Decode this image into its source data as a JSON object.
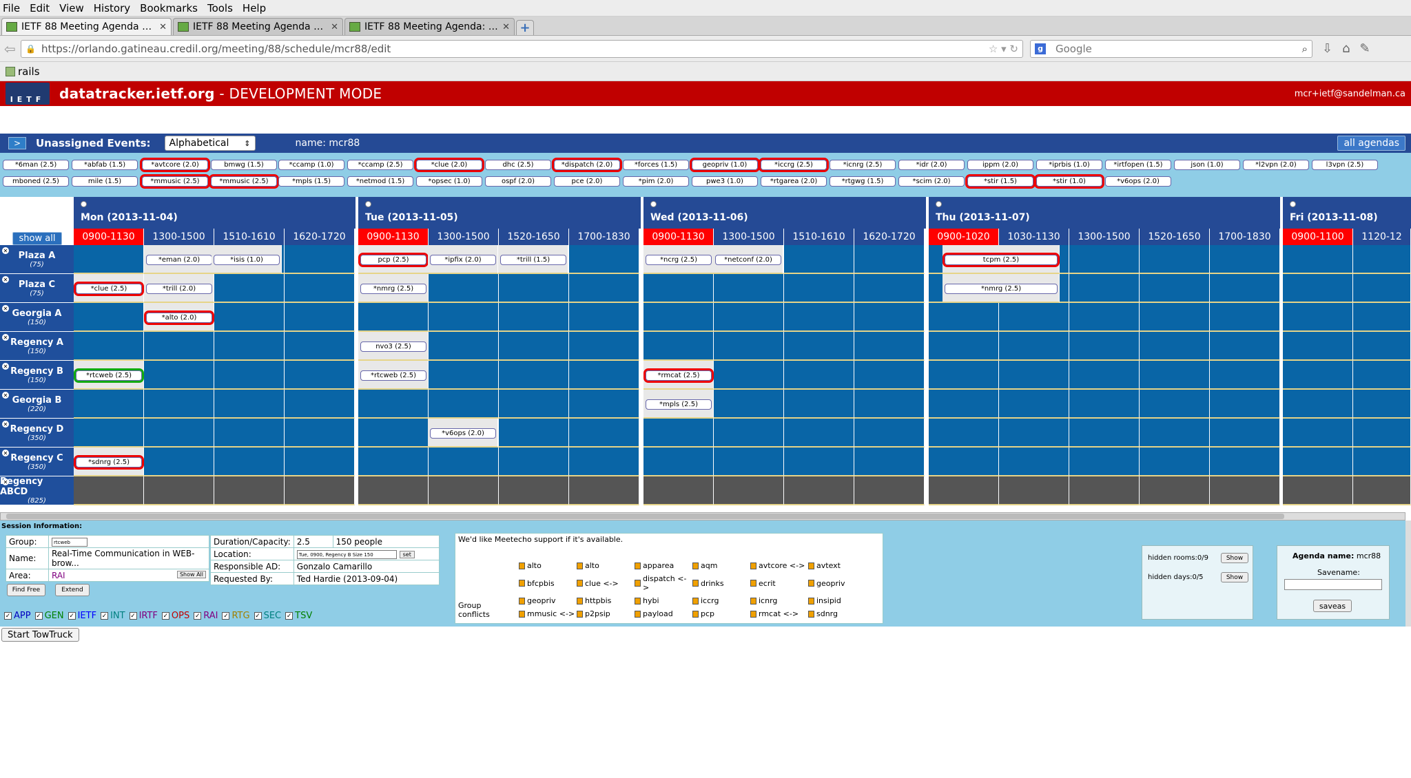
{
  "menu": [
    "File",
    "Edit",
    "View",
    "History",
    "Bookmarks",
    "Tools",
    "Help"
  ],
  "tabs": [
    {
      "title": "IETF 88 Meeting Agenda - D...",
      "active": true
    },
    {
      "title": "IETF 88 Meeting Agenda - D...",
      "active": false
    },
    {
      "title": "IETF 88 Meeting Agenda: Ti...",
      "active": false
    }
  ],
  "nav": {
    "url": "https://orlando.gatineau.credil.org/meeting/88/schedule/mcr88/edit",
    "search_placeholder": "Google"
  },
  "bookmarks": [
    "rails"
  ],
  "site": {
    "name": "datatracker.ietf.org",
    "mode": " - DEVELOPMENT MODE",
    "user": "mcr+ietf@sandelman.ca",
    "logo": "IETF"
  },
  "unassigned_bar": {
    "toggle": ">",
    "title": "Unassigned Events:",
    "sort": "Alphabetical",
    "name": "name: mcr88",
    "all_agendas": "all agendas"
  },
  "unassigned_row1": [
    "*6man (2.5)",
    "*abfab (1.5)",
    "*avtcore (2.0)",
    "bmwg (1.5)",
    "*ccamp (1.0)",
    "*ccamp (2.5)",
    "*clue (2.0)",
    "dhc (2.5)",
    "*dispatch (2.0)",
    "*forces (1.5)",
    "geopriv (1.0)",
    "*iccrg (2.5)",
    "*icnrg (2.5)",
    "*idr (2.0)",
    "ippm (2.0)",
    "*iprbis (1.0)",
    "*irtfopen (1.5)",
    "json (1.0)",
    "*l2vpn (2.0)",
    "l3vpn (2.5)"
  ],
  "unassigned_row2": [
    "mboned (2.5)",
    "mile (1.5)",
    "*mmusic (2.5)",
    "*mmusic (2.5)",
    "*mpls (1.5)",
    "*netmod (1.5)",
    "*opsec (1.0)",
    "ospf (2.0)",
    "pce (2.0)",
    "*pim (2.0)",
    "pwe3 (1.0)",
    "*rtgarea (2.0)",
    "*rtgwg (1.5)",
    "*scim (2.0)",
    "*stir (1.5)",
    "*stir (1.0)",
    "*v6ops (2.0)"
  ],
  "show_all": "show all",
  "days": [
    {
      "label": "Mon (2013-11-04)",
      "slots": [
        "0900-1130",
        "1300-1500",
        "1510-1610",
        "1620-1720"
      ]
    },
    {
      "label": "Tue (2013-11-05)",
      "slots": [
        "0900-1130",
        "1300-1500",
        "1520-1650",
        "1700-1830"
      ]
    },
    {
      "label": "Wed (2013-11-06)",
      "slots": [
        "0900-1130",
        "1300-1500",
        "1510-1610",
        "1620-1720"
      ]
    },
    {
      "label": "Thu (2013-11-07)",
      "slots": [
        "0900-1020",
        "1030-1130",
        "1300-1500",
        "1520-1650",
        "1700-1830"
      ]
    },
    {
      "label": "Fri (2013-11-08)",
      "slots": [
        "0900-1100",
        "1120-12"
      ]
    }
  ],
  "rooms": [
    {
      "name": "Plaza A",
      "cap": "(75)"
    },
    {
      "name": "Plaza C",
      "cap": "(75)"
    },
    {
      "name": "Georgia A",
      "cap": "(150)"
    },
    {
      "name": "Regency A",
      "cap": "(150)"
    },
    {
      "name": "Regency B",
      "cap": "(150)"
    },
    {
      "name": "Georgia B",
      "cap": "(220)"
    },
    {
      "name": "Regency D",
      "cap": "(350)"
    },
    {
      "name": "Regency C",
      "cap": "(350)"
    },
    {
      "name": "Regency ABCD",
      "cap": "(825)"
    }
  ],
  "events": [
    {
      "label": "*eman (2.0)"
    },
    {
      "label": "*isis (1.0)"
    },
    {
      "label": "pcp (2.5)"
    },
    {
      "label": "*ipfix (2.0)"
    },
    {
      "label": "*trill (1.5)"
    },
    {
      "label": "*ncrg (2.5)"
    },
    {
      "label": "*netconf (2.0)"
    },
    {
      "label": "tcpm (2.5)"
    },
    {
      "label": "*clue (2.5)"
    },
    {
      "label": "*trill (2.0)"
    },
    {
      "label": "*nmrg (2.5)"
    },
    {
      "label": "*nmrg (2.5)"
    },
    {
      "label": "*alto (2.0)"
    },
    {
      "label": "nvo3 (2.5)"
    },
    {
      "label": "*rtcweb (2.5)"
    },
    {
      "label": "*rtcweb (2.5)"
    },
    {
      "label": "*rmcat (2.5)"
    },
    {
      "label": "*mpls (2.5)"
    },
    {
      "label": "*v6ops (2.0)"
    },
    {
      "label": "*sdnrg (2.5)"
    }
  ],
  "session": {
    "title": "Session Information:",
    "group_label": "Group:",
    "group_value": "rtcweb",
    "name_label": "Name:",
    "name_value": "Real-Time Communication in WEB-brow...",
    "area_label": "Area:",
    "area_value": "RAI",
    "show_all": "Show All",
    "duration_label": "Duration/Capacity:",
    "duration": "2.5",
    "capacity": "150 people",
    "location_label": "Location:",
    "location_value": "Tue, 0900, Regency B Size 150",
    "set": "set",
    "ad_label": "Responsible AD:",
    "ad_value": "Gonzalo Camarillo",
    "req_label": "Requested By:",
    "req_value": "Ted Hardie (2013-09-04)",
    "find_free": "Find Free",
    "extend": "Extend"
  },
  "areas": [
    "APP",
    "GEN",
    "IETF",
    "INT",
    "IRTF",
    "OPS",
    "RAI",
    "RTG",
    "SEC",
    "TSV"
  ],
  "area_colors": {
    "APP": "#0000c0",
    "GEN": "#008000",
    "IETF": "#0000ff",
    "INT": "#008080",
    "IRTF": "#800080",
    "OPS": "#c00000",
    "RAI": "#800080",
    "RTG": "#a08000",
    "SEC": "#008080",
    "TSV": "#008000"
  },
  "meetecho": "We'd like Meetecho support if it's available.",
  "group_conflicts_label": "Group conflicts",
  "conflicts": [
    "alto",
    "alto",
    "apparea",
    "aqm",
    "avtcore <->",
    "avtext",
    "bfcpbis",
    "clue <->",
    "dispatch <->",
    "drinks",
    "ecrit",
    "geopriv",
    "geopriv",
    "httpbis",
    "hybi",
    "iccrg",
    "icnrg",
    "insipid",
    "mmusic <->",
    "p2psip",
    "payload",
    "pcp",
    "rmcat <->",
    "sdnrg"
  ],
  "hidden": {
    "rooms": "hidden rooms:0/9",
    "days": "hidden days:0/5",
    "show": "Show"
  },
  "agenda": {
    "name_label": "Agenda name:",
    "name": "mcr88",
    "savename_label": "Savename:",
    "saveas": "saveas"
  },
  "towtruck": "Start TowTruck"
}
